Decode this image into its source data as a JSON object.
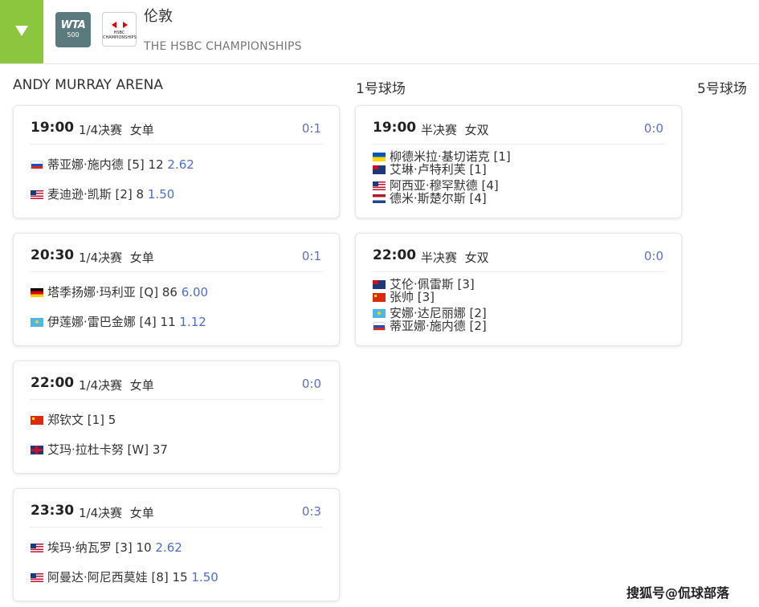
{
  "header": {
    "toggle_icon": "triangle-down-icon",
    "accent_color": "#8cc63f",
    "wta_logo_text": "WTA",
    "wta_logo_sub": "500",
    "hsbc_logo_text": "HSBC CHAMPIONSHIPS",
    "city": "伦敦",
    "tournament": "THE HSBC CHAMPIONSHIPS"
  },
  "courts": [
    {
      "name": "ANDY MURRAY ARENA",
      "matches": [
        {
          "time": "19:00",
          "round": "1/4决赛",
          "event": "女单",
          "score": "0:1",
          "p1": {
            "flag": "ru",
            "text": "蒂亚娜·施内德 [5] 12",
            "odds": "2.62"
          },
          "p2": {
            "flag": "us",
            "text": "麦迪逊·凯斯 [2] 8",
            "odds": "1.50"
          }
        },
        {
          "time": "20:30",
          "round": "1/4决赛",
          "event": "女单",
          "score": "0:1",
          "p1": {
            "flag": "de",
            "text": "塔季扬娜·玛利亚 [Q] 86",
            "odds": "6.00"
          },
          "p2": {
            "flag": "kz",
            "text": "伊莲娜·雷巴金娜 [4] 11",
            "odds": "1.12"
          }
        },
        {
          "time": "22:00",
          "round": "1/4决赛",
          "event": "女单",
          "score": "0:0",
          "p1": {
            "flag": "cn",
            "text": "郑钦文 [1] 5",
            "odds": ""
          },
          "p2": {
            "flag": "gb",
            "text": "艾玛·拉杜卡努 [W] 37",
            "odds": ""
          }
        },
        {
          "time": "23:30",
          "round": "1/4决赛",
          "event": "女单",
          "score": "0:3",
          "p1": {
            "flag": "us",
            "text": "埃玛·纳瓦罗 [3] 10",
            "odds": "2.62"
          },
          "p2": {
            "flag": "us",
            "text": "阿曼达·阿尼西莫娃 [8] 15",
            "odds": "1.50"
          }
        }
      ]
    },
    {
      "name": "1号球场",
      "matches": [
        {
          "time": "19:00",
          "round": "半决赛",
          "event": "女双",
          "score": "0:0",
          "team1": [
            {
              "flag": "ua",
              "text": "柳德米拉·基切诺克 [1]"
            },
            {
              "flag": "nz",
              "text": "艾琳·卢特利芙 [1]"
            }
          ],
          "team2": [
            {
              "flag": "us",
              "text": "阿西亚·穆罕默德 [4]"
            },
            {
              "flag": "nl",
              "text": "德米·斯楚尔斯 [4]"
            }
          ]
        },
        {
          "time": "22:00",
          "round": "半决赛",
          "event": "女双",
          "score": "0:0",
          "team1": [
            {
              "flag": "au",
              "text": "艾伦·佩雷斯 [3]"
            },
            {
              "flag": "cn",
              "text": "张帅 [3]"
            }
          ],
          "team2": [
            {
              "flag": "kz",
              "text": "安娜·达尼丽娜 [2]"
            },
            {
              "flag": "ru",
              "text": "蒂亚娜·施内德 [2]"
            }
          ]
        }
      ]
    },
    {
      "name": "5号球场",
      "matches": []
    }
  ],
  "watermark": "搜狐号@侃球部落"
}
